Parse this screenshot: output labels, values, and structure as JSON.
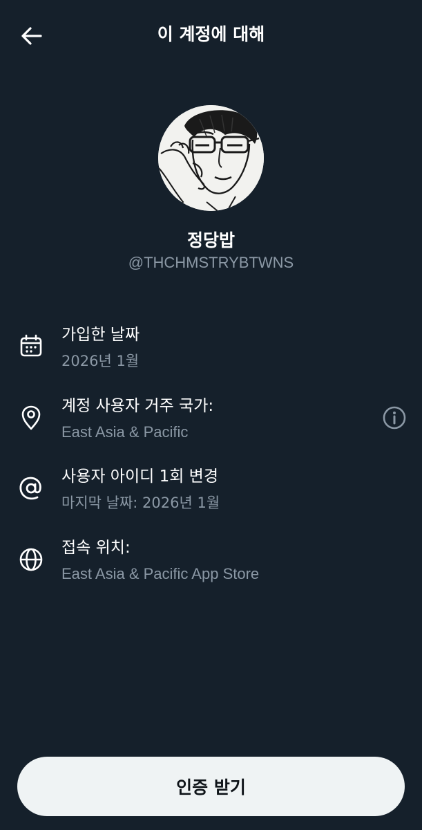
{
  "header": {
    "back_icon": "arrow-left-icon",
    "title": "이 계정에 대해"
  },
  "profile": {
    "avatar_desc": "avatar",
    "display_name": "정당밥",
    "handle": "@THCHMSTRYBTWNS"
  },
  "rows": [
    {
      "icon": "calendar-icon",
      "title": "가입한 날짜",
      "value": "2026년 1월"
    },
    {
      "icon": "location-pin-icon",
      "title": "계정 사용자 거주 국가:",
      "value": "East Asia & Pacific",
      "action_icon": "info-icon"
    },
    {
      "icon": "at-sign-icon",
      "title": "사용자 아이디 1회 변경",
      "value": "마지막 날짜: 2026년 1월"
    },
    {
      "icon": "globe-icon",
      "title": "접속 위치:",
      "value": "East Asia & Pacific App Store"
    }
  ],
  "footer": {
    "verify_label": "인증 받기"
  },
  "colors": {
    "background": "#15202b",
    "primary_text": "#ffffff",
    "secondary_text": "#8b98a5",
    "button_bg": "#eff3f4",
    "button_text": "#0f1419"
  }
}
